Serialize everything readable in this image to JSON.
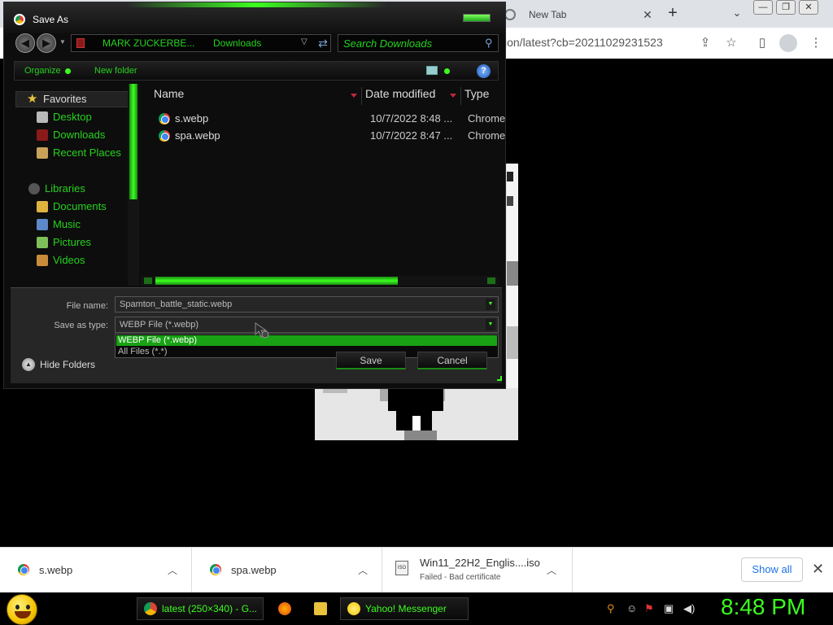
{
  "browser": {
    "tab_title": "New Tab",
    "tab_close": "✕",
    "new_tab": "+",
    "tab_search": "⌄",
    "window_controls": [
      "—",
      "❐",
      "✕"
    ],
    "omnibox_text": "ion/latest?cb=20211029231523"
  },
  "dialog": {
    "title": "Save As",
    "nav": {
      "back": "◀",
      "forward": "▶",
      "breadcrumbs": [
        "MARK ZUCKERBE...",
        "Downloads"
      ],
      "search_placeholder": "Search Downloads"
    },
    "commands": {
      "organize": "Organize",
      "new_folder": "New folder",
      "help": "?"
    },
    "nav_pane": {
      "favorites": "Favorites",
      "favorite_items": [
        "Desktop",
        "Downloads",
        "Recent Places"
      ],
      "libraries": "Libraries",
      "library_items": [
        "Documents",
        "Music",
        "Pictures",
        "Videos"
      ]
    },
    "columns": [
      "Name",
      "Date modified",
      "Type"
    ],
    "files": [
      {
        "name": "s.webp",
        "date": "10/7/2022 8:48 ...",
        "type": "Chrome"
      },
      {
        "name": "spa.webp",
        "date": "10/7/2022 8:47 ...",
        "type": "Chrome"
      }
    ],
    "file_name_label": "File name:",
    "file_name_value": "Spamton_battle_static.webp",
    "save_type_label": "Save as type:",
    "save_type_value": "WEBP File (*.webp)",
    "save_type_options": [
      "WEBP File (*.webp)",
      "All Files (*.*)"
    ],
    "save_button": "Save",
    "cancel_button": "Cancel",
    "hide_folders": "Hide Folders"
  },
  "downloads": {
    "items": [
      {
        "name": "s.webp"
      },
      {
        "name": "spa.webp"
      },
      {
        "name": "Win11_22H2_Englis....iso",
        "status": "Failed - Bad certificate"
      }
    ],
    "iso_label": "ISO",
    "show_all": "Show all",
    "close": "✕"
  },
  "taskbar": {
    "tasks": [
      "latest (250×340) - G...",
      "Yahoo! Messenger"
    ],
    "clock": "8:48 PM"
  },
  "colors": {
    "accent_green": "#3cff1f",
    "dialog_bg": "#0d0d0d",
    "selection_green": "#18a214"
  }
}
